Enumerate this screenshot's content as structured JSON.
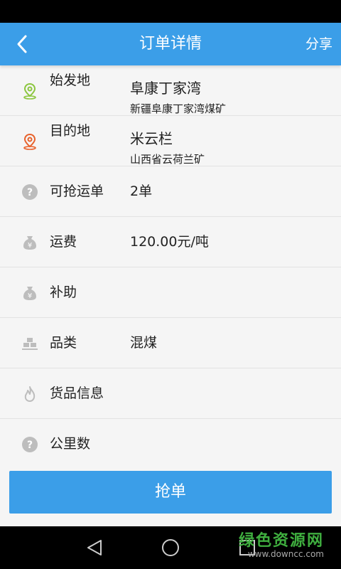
{
  "header": {
    "title": "订单详情",
    "share_label": "分享"
  },
  "origin": {
    "label": "始发地",
    "name": "阜康丁家湾",
    "detail": "新疆阜康丁家湾煤矿"
  },
  "destination": {
    "label": "目的地",
    "name": "米云栏",
    "detail": "山西省云荷兰矿"
  },
  "rows": [
    {
      "label": "可抢运单",
      "value": "2单",
      "icon": "question-circle-icon"
    },
    {
      "label": "运费",
      "value": "120.00元/吨",
      "icon": "money-bag-icon"
    },
    {
      "label": "补助",
      "value": "",
      "icon": "money-bag-icon"
    },
    {
      "label": "品类",
      "value": "混煤",
      "icon": "stack-icon"
    },
    {
      "label": "货品信息",
      "value": "",
      "icon": "flame-icon"
    },
    {
      "label": "公里数",
      "value": "",
      "icon": "question-circle-icon"
    }
  ],
  "action": {
    "grab_label": "抢单"
  },
  "watermark": {
    "brand": "绿色资源网",
    "url": "www.downcc.com"
  },
  "colors": {
    "primary": "#3b9ee8",
    "origin_icon": "#8cc63f",
    "destination_icon": "#e8622c",
    "gray_icon": "#bdbdbd"
  }
}
